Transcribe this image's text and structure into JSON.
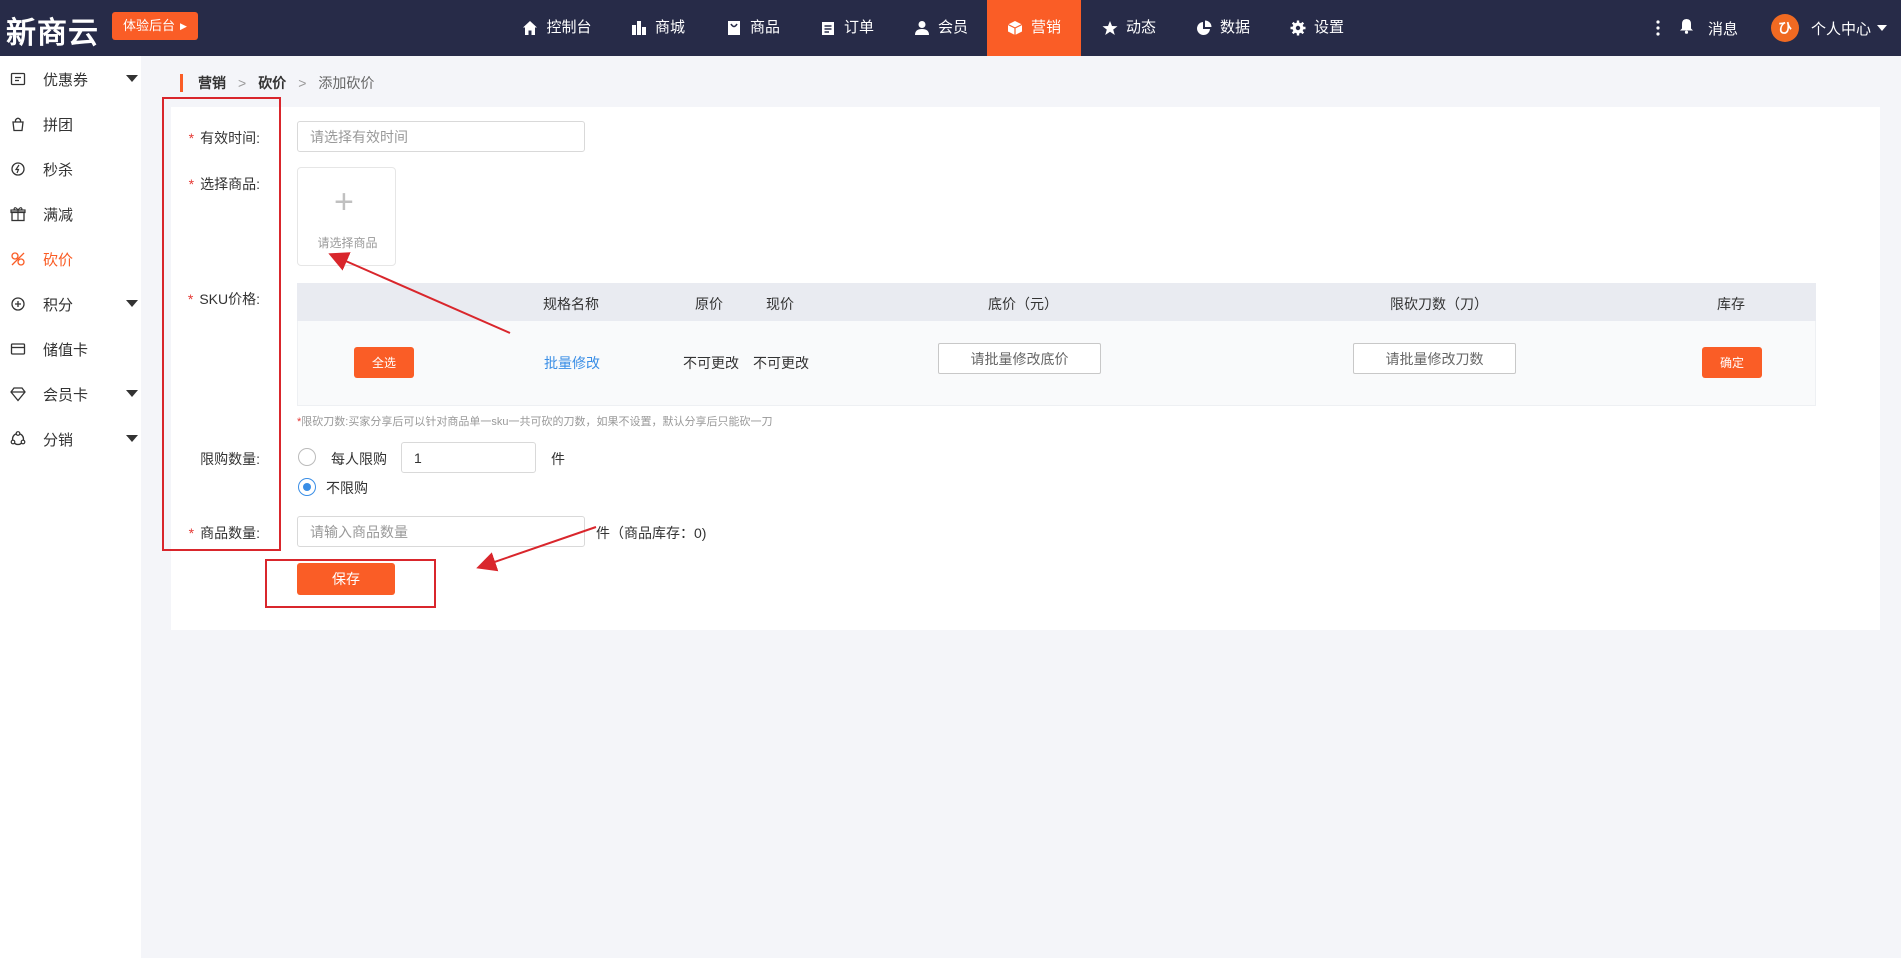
{
  "header": {
    "logo": "新商云",
    "trial_button": "体验后台",
    "nav": [
      {
        "label": "控制台",
        "icon": "home-icon"
      },
      {
        "label": "商城",
        "icon": "building-icon"
      },
      {
        "label": "商品",
        "icon": "bag-icon"
      },
      {
        "label": "订单",
        "icon": "clipboard-icon"
      },
      {
        "label": "会员",
        "icon": "user-icon"
      },
      {
        "label": "营销",
        "icon": "cube-icon",
        "active": true
      },
      {
        "label": "动态",
        "icon": "star-icon"
      },
      {
        "label": "数据",
        "icon": "pie-chart-icon"
      },
      {
        "label": "设置",
        "icon": "gear-icon"
      }
    ],
    "messages": "消息",
    "user_center": "个人中心",
    "accent": "#fa5d26",
    "bar_color": "#272b48"
  },
  "sidebar": {
    "items": [
      {
        "label": "优惠券",
        "icon": "coupon-icon",
        "has_submenu": true
      },
      {
        "label": "拼团",
        "icon": "group-buy-icon"
      },
      {
        "label": "秒杀",
        "icon": "flash-sale-icon"
      },
      {
        "label": "满减",
        "icon": "gift-icon"
      },
      {
        "label": "砍价",
        "icon": "bargain-icon",
        "active": true
      },
      {
        "label": "积分",
        "icon": "points-icon",
        "has_submenu": true
      },
      {
        "label": "储值卡",
        "icon": "card-icon"
      },
      {
        "label": "会员卡",
        "icon": "diamond-icon",
        "has_submenu": true
      },
      {
        "label": "分销",
        "icon": "distribution-icon",
        "has_submenu": true
      }
    ]
  },
  "breadcrumb": [
    "营销",
    "砍价",
    "添加砍价"
  ],
  "breadcrumb_sep": ">",
  "form": {
    "valid_time": {
      "label": "有效时间:",
      "placeholder": "请选择有效时间"
    },
    "select_goods": {
      "label": "选择商品:",
      "upload_text": "请选择商品"
    },
    "sku": {
      "label": "SKU价格:",
      "headers": [
        "规格名称",
        "原价",
        "现价",
        "底价（元）",
        "限砍刀数（刀）",
        "库存"
      ],
      "select_all": "全选",
      "batch_edit": "批量修改",
      "original_price": "不可更改",
      "current_price": "不可更改",
      "floor_price_placeholder": "请批量修改底价",
      "cut_count_placeholder": "请批量修改刀数",
      "confirm": "确定"
    },
    "hint": "限砍刀数:买家分享后可以针对商品单一sku一共可砍的刀数，如果不设置，默认分享后只能砍一刀",
    "limit": {
      "label": "限购数量:",
      "per_person": "每人限购",
      "per_person_value": "1",
      "unit": "件",
      "unlimited": "不限购",
      "selected": "unlimited"
    },
    "goods_count": {
      "label": "商品数量:",
      "placeholder": "请输入商品数量",
      "suffix": "件（商品库存：0)"
    },
    "save": "保存"
  },
  "annotation_color": "#d9262c"
}
